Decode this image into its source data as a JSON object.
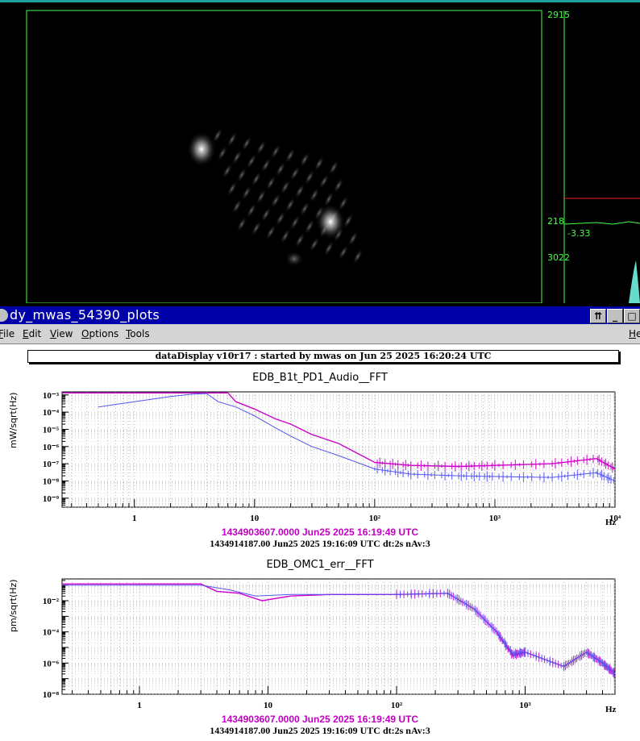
{
  "camera": {
    "scale_top": "2915",
    "scale_mid": "218",
    "scale_neg": "-3.33",
    "hist2_top": "3022"
  },
  "window": {
    "title": "dy_mwas_54390_plots",
    "buttons": {
      "raise": "⇈",
      "minimize": "_",
      "maximize": "□"
    }
  },
  "menu": {
    "file": "File",
    "edit": "Edit",
    "view": "View",
    "options": "Options",
    "tools": "Tools",
    "help": "He"
  },
  "banner": "dataDisplay v10r17 : started by mwas on Jun 25 2025 16:20:24 UTC",
  "plots": [
    {
      "title": "EDB_B1t_PD1_Audio__FFT",
      "ylabel": "mW/sqrt(Hz)",
      "xunit": "Hz",
      "ref_time": "1434903607.0000 Jun25 2025 16:19:49 UTC",
      "cur_time": "1434914187.00 Jun25 2025 19:16:09 UTC dt:2s nAv:3",
      "x_ticks": [
        "1",
        "10",
        "10²",
        "10³",
        "10⁴"
      ],
      "y_ticks": [
        "10⁻³",
        "10⁻⁴",
        "10⁻⁵",
        "10⁻⁶",
        "10⁻⁷",
        "10⁻⁸",
        "10⁻⁹"
      ]
    },
    {
      "title": "EDB_OMC1_err__FFT",
      "ylabel": "pm/sqrt(Hz)",
      "xunit": "Hz",
      "ref_time": "1434903607.0000 Jun25 2025 16:19:49 UTC",
      "cur_time": "1434914187.00 Jun25 2025 19:16:09 UTC dt:2s nAv:3",
      "x_ticks": [
        "1",
        "10",
        "10²",
        "10³"
      ],
      "y_ticks": [
        "10⁻²",
        "10⁻⁴",
        "10⁻⁶",
        "10⁻⁸"
      ]
    }
  ],
  "chart_data": [
    {
      "type": "line",
      "title": "EDB_B1t_PD1_Audio__FFT",
      "ylabel": "mW/sqrt(Hz)",
      "xlabel": "Hz",
      "xscale": "log",
      "yscale": "log",
      "xlim": [
        0.25,
        10000
      ],
      "ylim": [
        3e-10,
        0.0015
      ],
      "series": [
        {
          "color": "#cc00cc",
          "x": [
            0.25,
            1,
            3,
            6,
            7,
            10,
            15,
            20,
            30,
            50,
            100,
            200,
            500,
            1000,
            3000,
            7000,
            10000
          ],
          "y": [
            0.0013,
            0.0013,
            0.0013,
            0.0013,
            0.0004,
            0.00015,
            4e-05,
            2e-05,
            5e-06,
            1.5e-06,
            1.2e-07,
            8e-08,
            7e-08,
            8e-08,
            1e-07,
            2e-07,
            5e-08
          ]
        },
        {
          "color": "#5555ee",
          "x": [
            0.5,
            1,
            2,
            3,
            4,
            5,
            7,
            10,
            15,
            20,
            30,
            50,
            100,
            200,
            500,
            1000,
            3000,
            7000,
            10000
          ],
          "y": [
            0.0002,
            0.0004,
            0.0008,
            0.0011,
            0.0012,
            0.0004,
            0.0002,
            6e-05,
            1.2e-05,
            4e-06,
            1e-06,
            3e-07,
            5e-08,
            2.5e-08,
            2e-08,
            1.8e-08,
            1.6e-08,
            3e-08,
            1e-08
          ]
        }
      ]
    },
    {
      "type": "line",
      "title": "EDB_OMC1_err__FFT",
      "ylabel": "pm/sqrt(Hz)",
      "xlabel": "Hz",
      "xscale": "log",
      "yscale": "log",
      "xlim": [
        0.25,
        5000
      ],
      "ylim": [
        1e-08,
        0.25
      ],
      "series": [
        {
          "color": "#cc00cc",
          "x": [
            0.25,
            1,
            3,
            4,
            6,
            9,
            15,
            30,
            100,
            250,
            400,
            600,
            800,
            1000,
            2000,
            3000,
            4000,
            5000
          ],
          "y": [
            0.12,
            0.12,
            0.12,
            0.04,
            0.03,
            0.01,
            0.02,
            0.025,
            0.025,
            0.03,
            0.003,
            0.0001,
            3e-06,
            5e-06,
            6e-07,
            5e-06,
            1e-06,
            2e-07
          ]
        },
        {
          "color": "#5555ee",
          "x": [
            0.25,
            1,
            3,
            5,
            8,
            15,
            30,
            100,
            250,
            400,
            600,
            800,
            1000,
            2000,
            3000,
            4000,
            5000
          ],
          "y": [
            0.1,
            0.1,
            0.1,
            0.05,
            0.02,
            0.025,
            0.025,
            0.025,
            0.03,
            0.003,
            0.0001,
            4e-06,
            5e-06,
            6e-07,
            5e-06,
            1e-06,
            2e-07
          ]
        }
      ]
    }
  ]
}
